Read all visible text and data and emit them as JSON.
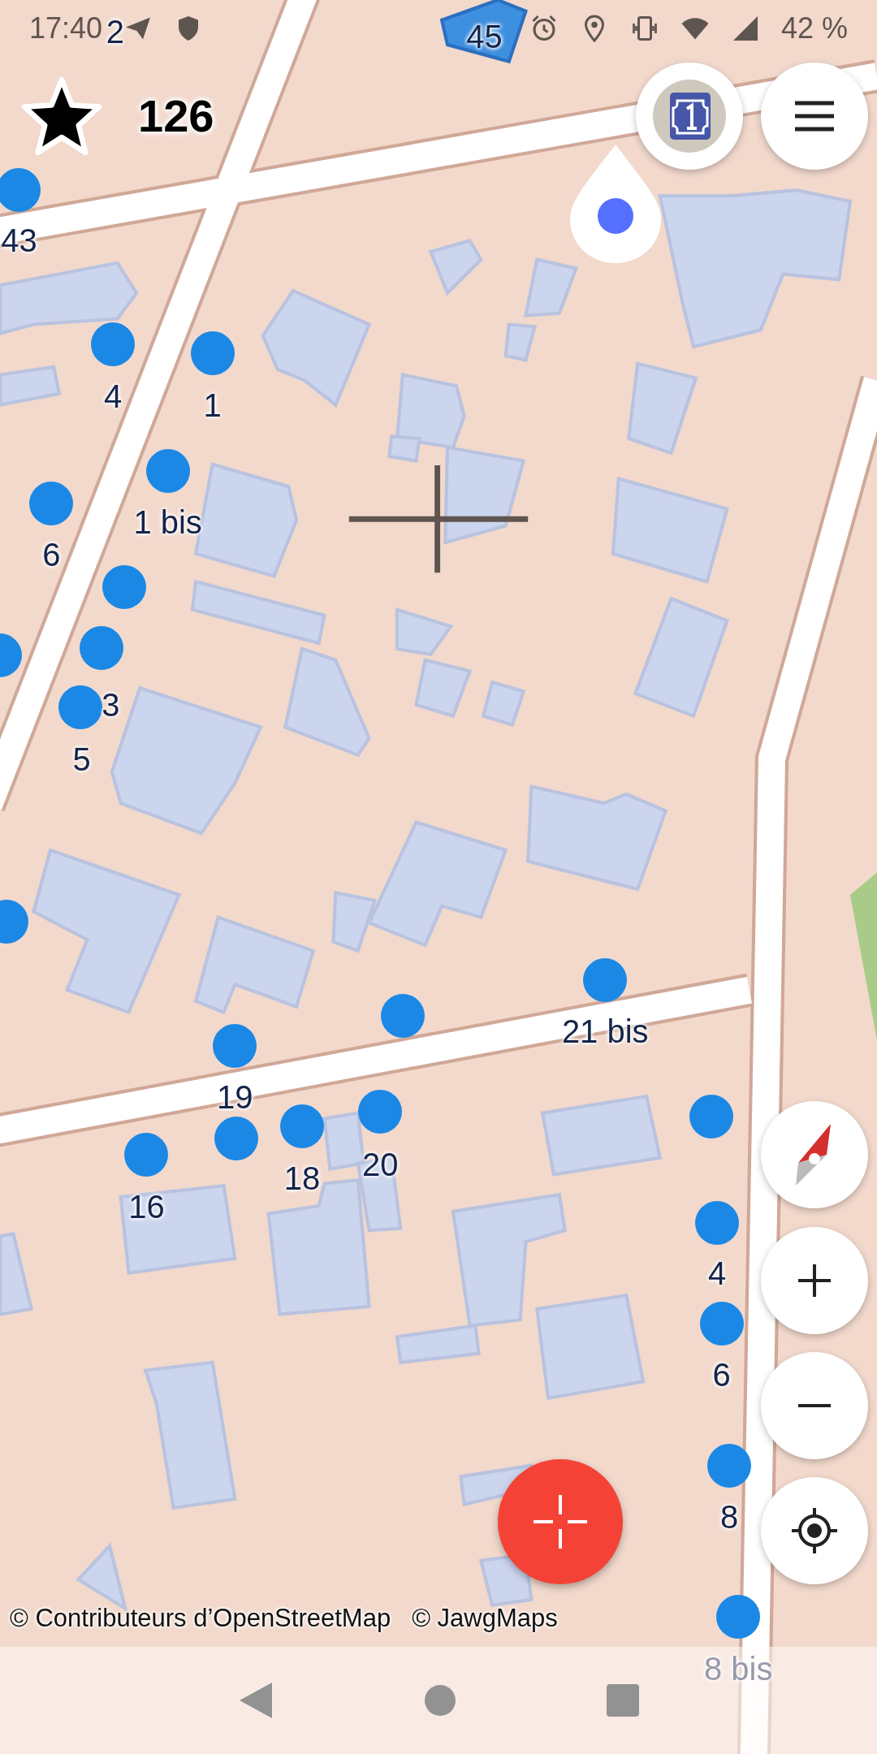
{
  "status_bar": {
    "time": "17:40",
    "battery": "42 %"
  },
  "score": {
    "count": "126"
  },
  "map_labels": [
    {
      "text": "2"
    },
    {
      "text": "45"
    },
    {
      "text": "43"
    },
    {
      "text": "4"
    },
    {
      "text": "1"
    },
    {
      "text": "1 bis"
    },
    {
      "text": "6"
    },
    {
      "text": "3"
    },
    {
      "text": "5"
    },
    {
      "text": "21 bis"
    },
    {
      "text": "19"
    },
    {
      "text": "18"
    },
    {
      "text": "20"
    },
    {
      "text": "16"
    },
    {
      "text": "4"
    },
    {
      "text": "6"
    },
    {
      "text": "8"
    },
    {
      "text": "8 bis"
    }
  ],
  "attribution": [
    "© Contributeurs d’OpenStreetMap",
    "© JawgMaps"
  ]
}
